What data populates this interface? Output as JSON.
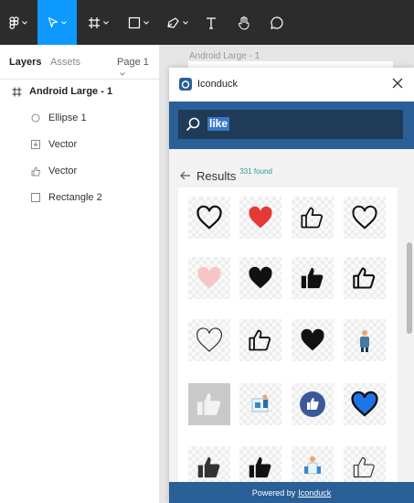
{
  "layers_panel": {
    "tabs": {
      "layers": "Layers",
      "assets": "Assets",
      "page": "Page 1"
    },
    "frame": "Android Large - 1",
    "items": [
      {
        "label": "Ellipse 1",
        "icon": "ellipse-icon"
      },
      {
        "label": "Vector",
        "icon": "vector-image-icon"
      },
      {
        "label": "Vector",
        "icon": "thumb-vector-icon"
      },
      {
        "label": "Rectangle 2",
        "icon": "rectangle-icon"
      }
    ]
  },
  "canvas": {
    "frame_label": "Android Large - 1"
  },
  "plugin": {
    "title": "Iconduck",
    "search_value": "like",
    "results_label": "Results",
    "results_count": "331 found",
    "footer_prefix": "Powered by",
    "footer_link": "Iconduck",
    "brand_color": "#2a5f97",
    "results": [
      "heart-outline",
      "heart-red",
      "thumbs-up-outline",
      "heart-outline",
      "heart-pink",
      "heart-black",
      "thumbs-up-black",
      "thumbs-up-outline",
      "heart-outline-thin",
      "thumbs-up-outline",
      "heart-black",
      "person-illustration",
      "thumbs-up-grey-box",
      "like-illustration",
      "thumbs-up-circle",
      "heart-blue",
      "thumbs-up-dark",
      "thumbs-up-black",
      "people-illustration",
      "thumbs-up-outline"
    ]
  }
}
